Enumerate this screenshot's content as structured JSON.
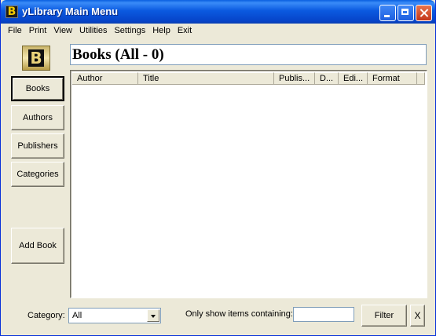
{
  "window": {
    "title": "yLibrary Main Menu",
    "app_icon_glyph": "B"
  },
  "menu": [
    "File",
    "Print",
    "View",
    "Utilities",
    "Settings",
    "Help",
    "Exit"
  ],
  "logo_glyph": "B",
  "sidebar": {
    "books": "Books",
    "authors": "Authors",
    "publishers": "Publishers",
    "categories": "Categories",
    "add_book": "Add Book"
  },
  "heading": "Books (All - 0)",
  "table": {
    "columns": [
      "Author",
      "Title",
      "Publis...",
      "D...",
      "Edi...",
      "Format"
    ],
    "rows": []
  },
  "footer": {
    "category_label": "Category:",
    "category_value": "All",
    "filter_label": "Only show items containing:",
    "filter_value": "",
    "filter_button": "Filter",
    "clear_button": "X"
  },
  "colors": {
    "titlebar": "#0b5ae0",
    "face": "#ece9d8",
    "logo_gold": "#e9d27a"
  }
}
